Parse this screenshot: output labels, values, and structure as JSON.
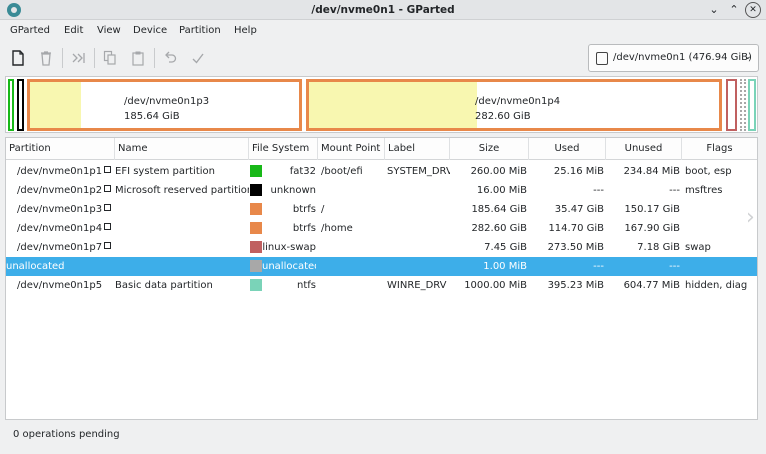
{
  "window": {
    "title": "/dev/nvme0n1 - GParted"
  },
  "menu": [
    "GParted",
    "Edit",
    "View",
    "Device",
    "Partition",
    "Help"
  ],
  "toolbar": {
    "icons": [
      "new-icon",
      "delete-icon",
      "resize-move-icon",
      "copy-icon",
      "paste-icon",
      "undo-icon",
      "apply-icon"
    ]
  },
  "device": {
    "label": "/dev/nvme0n1 (476.94 GiB)"
  },
  "diskmap": {
    "p3": {
      "name": "/dev/nvme0n1p3",
      "size": "185.64 GiB",
      "used_fraction": 0.19
    },
    "p4": {
      "name": "/dev/nvme0n1p4",
      "size": "282.60 GiB",
      "used_fraction": 0.41
    }
  },
  "columns": [
    "Partition",
    "Name",
    "File System",
    "Mount Point",
    "Label",
    "Size",
    "Used",
    "Unused",
    "Flags"
  ],
  "rows": [
    {
      "partition": "/dev/nvme0n1p1",
      "name": "EFI system partition",
      "fs": "fat32",
      "mount": "/boot/efi",
      "label": "SYSTEM_DRV",
      "size": "260.00 MiB",
      "used": "25.16 MiB",
      "unused": "234.84 MiB",
      "flags": "boot, esp",
      "color": "#18b818"
    },
    {
      "partition": "/dev/nvme0n1p2",
      "name": "Microsoft reserved partition",
      "fs": "unknown",
      "mount": "",
      "label": "",
      "size": "16.00 MiB",
      "used": "---",
      "unused": "---",
      "flags": "msftres",
      "color": "#000000"
    },
    {
      "partition": "/dev/nvme0n1p3",
      "name": "",
      "fs": "btrfs",
      "mount": "/",
      "label": "",
      "size": "185.64 GiB",
      "used": "35.47 GiB",
      "unused": "150.17 GiB",
      "flags": "",
      "color": "#e8884a"
    },
    {
      "partition": "/dev/nvme0n1p4",
      "name": "",
      "fs": "btrfs",
      "mount": "/home",
      "label": "",
      "size": "282.60 GiB",
      "used": "114.70 GiB",
      "unused": "167.90 GiB",
      "flags": "",
      "color": "#e8884a"
    },
    {
      "partition": "/dev/nvme0n1p7",
      "name": "",
      "fs": "linux-swap",
      "mount": "",
      "label": "",
      "size": "7.45 GiB",
      "used": "273.50 MiB",
      "unused": "7.18 GiB",
      "flags": "swap",
      "color": "#c06060"
    },
    {
      "partition": "unallocated",
      "name": "",
      "fs": "unallocated",
      "mount": "",
      "label": "",
      "size": "1.00 MiB",
      "used": "---",
      "unused": "---",
      "flags": "",
      "color": "#a8a8a8"
    },
    {
      "partition": "/dev/nvme0n1p5",
      "name": "Basic data partition",
      "fs": "ntfs",
      "mount": "",
      "label": "WINRE_DRV",
      "size": "1000.00 MiB",
      "used": "395.23 MiB",
      "unused": "604.77 MiB",
      "flags": "hidden, diag",
      "color": "#7ad3b8"
    }
  ],
  "status": "0 operations pending"
}
